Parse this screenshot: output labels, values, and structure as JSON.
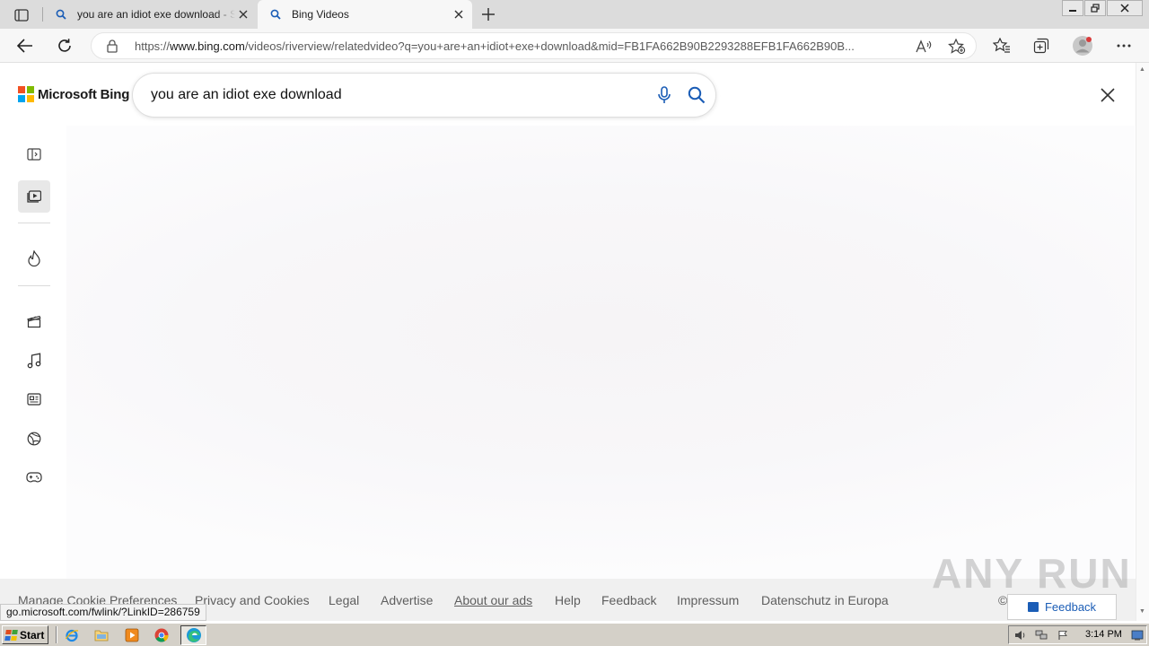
{
  "browser": {
    "tabs": [
      {
        "title": "you are an idiot exe download - S",
        "active": false
      },
      {
        "title": "Bing Videos",
        "active": true
      }
    ],
    "address": {
      "prefix": "https://",
      "domain": "www.bing.com",
      "path": "/videos/riverview/relatedvideo?q=you+are+an+idiot+exe+download&mid=FB1FA662B90B2293288EFB1FA662B90B..."
    },
    "status_url": "go.microsoft.com/fwlink/?LinkID=286759"
  },
  "bing": {
    "brand": "Microsoft Bing",
    "search_query": "you are an idiot exe download",
    "logo_colors": [
      "#f25022",
      "#7fba00",
      "#00a4ef",
      "#ffb900"
    ]
  },
  "rail": [
    "collapse-panel",
    "videos",
    "trending",
    "movies",
    "music",
    "news",
    "sports",
    "gaming"
  ],
  "footer": {
    "links": [
      {
        "label": "Manage Cookie Preferences",
        "underline": false
      },
      {
        "label": "Privacy and Cookies",
        "underline": false
      },
      {
        "label": "Legal",
        "underline": false
      },
      {
        "label": "Advertise",
        "underline": false
      },
      {
        "label": "About our ads",
        "underline": true
      },
      {
        "label": "Help",
        "underline": false
      },
      {
        "label": "Feedback",
        "underline": false
      },
      {
        "label": "Impressum",
        "underline": false
      },
      {
        "label": "Datenschutz in Europa",
        "underline": false
      }
    ],
    "copyright_glyph": "©",
    "feedback_button": "Feedback"
  },
  "watermark": "ANY RUN",
  "taskbar": {
    "start_label": "Start",
    "clock": "3:14 PM",
    "quick_launch": [
      "internet-explorer",
      "file-explorer",
      "media-player",
      "chrome",
      "edge"
    ]
  }
}
